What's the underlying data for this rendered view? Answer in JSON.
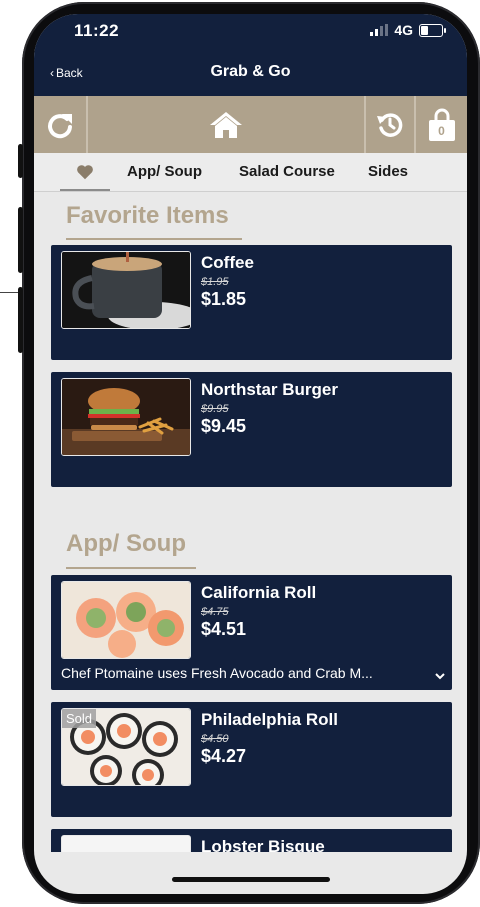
{
  "status_bar": {
    "time": "11:22",
    "network": "4G",
    "battery_level": 0.4
  },
  "nav": {
    "back_label": "Back",
    "title": "Grab & Go"
  },
  "toolbar": {
    "refresh_icon": "refresh-icon",
    "home_icon": "home-icon",
    "history_icon": "history-icon",
    "cart_icon": "bag-icon",
    "cart_count": "0"
  },
  "tabs": [
    {
      "icon": "heart-icon",
      "active": true
    },
    {
      "label": "App/ Soup"
    },
    {
      "label": "Salad Course"
    },
    {
      "label": "Sides"
    }
  ],
  "sections": [
    {
      "title": "Favorite Items",
      "items": [
        {
          "name": "Coffee",
          "old_price": "$1.95",
          "price": "$1.85"
        },
        {
          "name": "Northstar Burger",
          "old_price": "$9.95",
          "price": "$9.45"
        }
      ]
    },
    {
      "title": "App/ Soup",
      "items": [
        {
          "name": "California Roll",
          "old_price": "$4.75",
          "price": "$4.51",
          "description": "Chef Ptomaine uses Fresh Avocado and Crab M..."
        },
        {
          "name": "Philadelphia Roll",
          "old_price": "$4.50",
          "price": "$4.27",
          "badge": "Sold"
        },
        {
          "name": "Lobster Bisque"
        }
      ]
    }
  ],
  "colors": {
    "navy": "#12203d",
    "taupe": "#afa28c",
    "annotation": "#c8202e"
  }
}
